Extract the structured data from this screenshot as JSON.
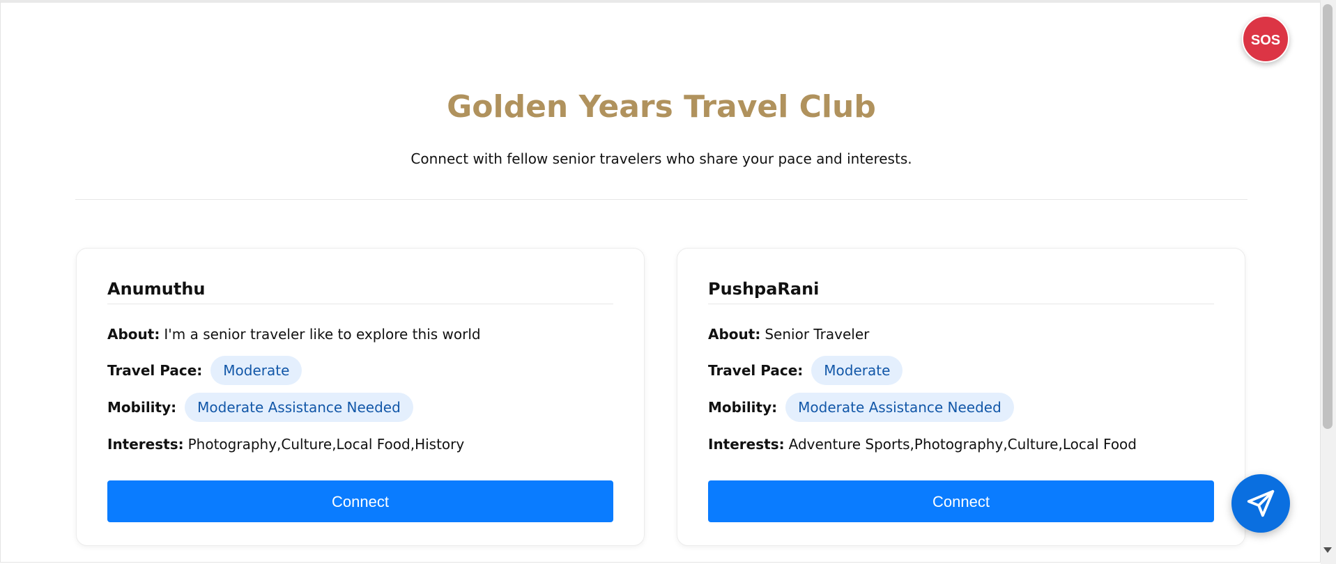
{
  "header": {
    "title": "Golden Years Travel Club",
    "subtitle": "Connect with fellow senior travelers who share your pace and interests."
  },
  "sos": {
    "label": "SOS",
    "color": "#dc3545"
  },
  "labels": {
    "about": "About:",
    "pace": "Travel Pace:",
    "mobility": "Mobility:",
    "interests": "Interests:"
  },
  "travelers": [
    {
      "name": "Anumuthu",
      "about": "I'm a senior traveler like to explore this world",
      "pace": "Moderate",
      "mobility": "Moderate Assistance Needed",
      "interests": "Photography,Culture,Local Food,History",
      "connect_label": "Connect"
    },
    {
      "name": "PushpaRani",
      "about": "Senior Traveler",
      "pace": "Moderate",
      "mobility": "Moderate Assistance Needed",
      "interests": "Adventure Sports,Photography,Culture,Local Food",
      "connect_label": "Connect"
    }
  ],
  "fab": {
    "icon": "send-icon"
  },
  "colors": {
    "title": "#b0925d",
    "button": "#0a7cff",
    "pill_bg": "#e4effd",
    "pill_text": "#1257a8"
  }
}
